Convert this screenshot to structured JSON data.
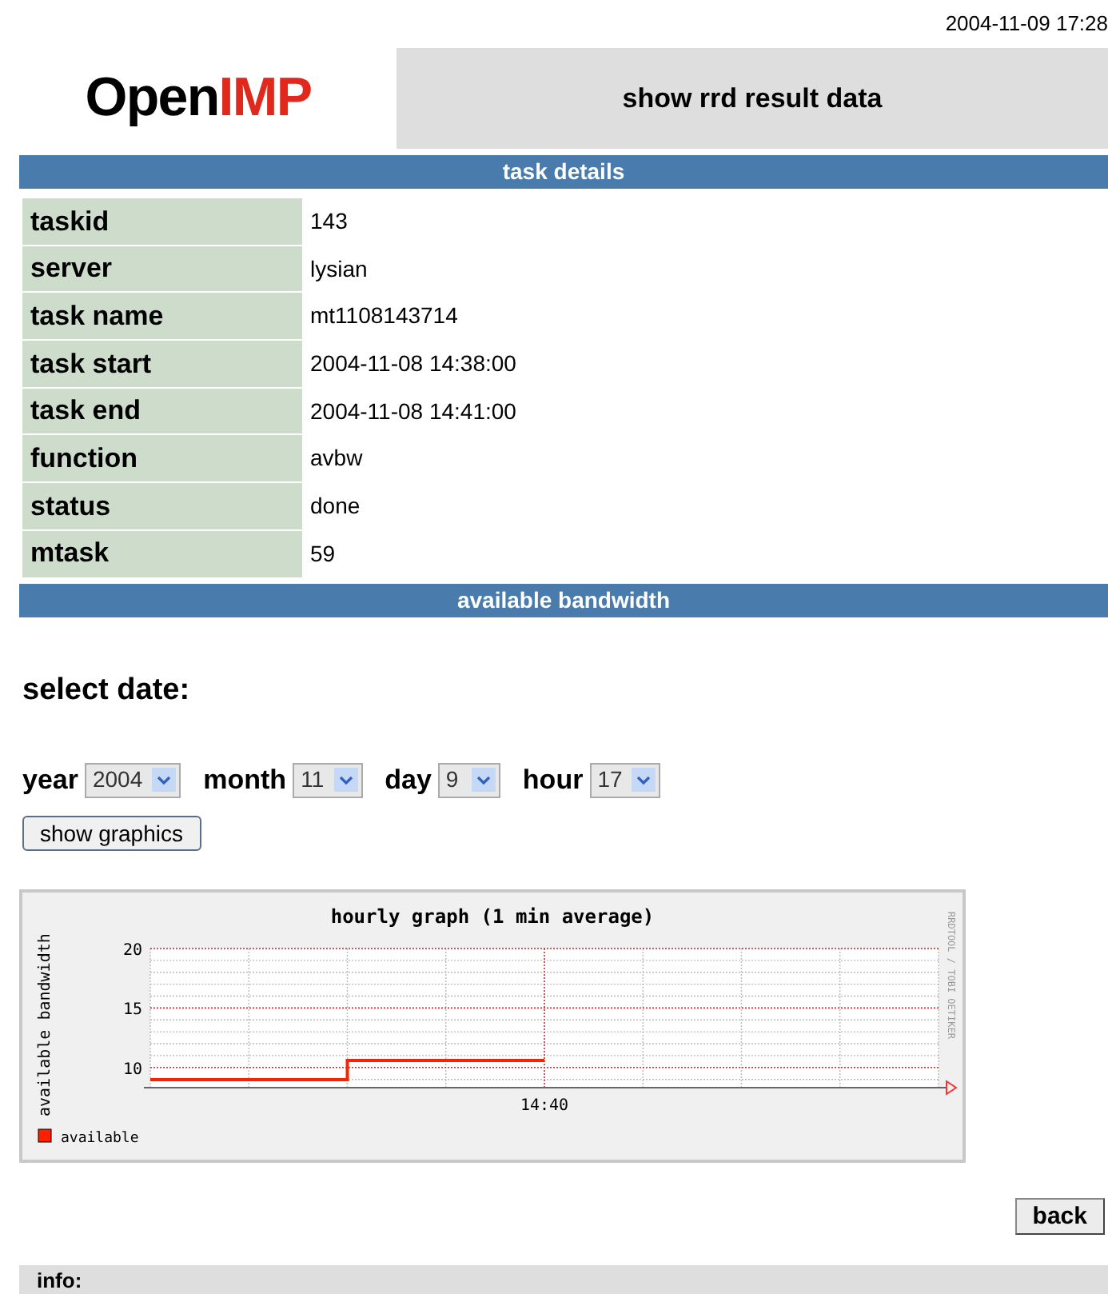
{
  "timestamp": "2004-11-09 17:28",
  "logo": {
    "part_1": "Open",
    "part_2": "IMP"
  },
  "page_title": "show rrd result data",
  "task_details": {
    "heading": "task details",
    "rows": [
      {
        "label": "taskid",
        "value": "143"
      },
      {
        "label": "server",
        "value": "lysian"
      },
      {
        "label": "task name",
        "value": "mt1108143714"
      },
      {
        "label": "task start",
        "value": "2004-11-08 14:38:00"
      },
      {
        "label": "task end",
        "value": "2004-11-08 14:41:00"
      },
      {
        "label": "function",
        "value": "avbw"
      },
      {
        "label": "status",
        "value": "done"
      },
      {
        "label": "mtask",
        "value": "59"
      }
    ]
  },
  "section_heading": "available bandwidth",
  "select_date": {
    "heading": "select date:",
    "fields": [
      {
        "label": "year",
        "value": "2004"
      },
      {
        "label": "month",
        "value": "11"
      },
      {
        "label": "day",
        "value": "9"
      },
      {
        "label": "hour",
        "value": "17"
      }
    ],
    "button": "show graphics"
  },
  "graph": {
    "title": "hourly graph (1 min average)",
    "ylabel": "available bandwidth",
    "side_note": "RRDTOOL / TOBI OETIKER",
    "y_tick_labels": [
      "20",
      "15",
      "10"
    ],
    "x_tick_label": "14:40",
    "legend": [
      {
        "name": "available",
        "color": "#ff2000"
      }
    ]
  },
  "back_button": "back",
  "info": {
    "label": "info:"
  }
}
